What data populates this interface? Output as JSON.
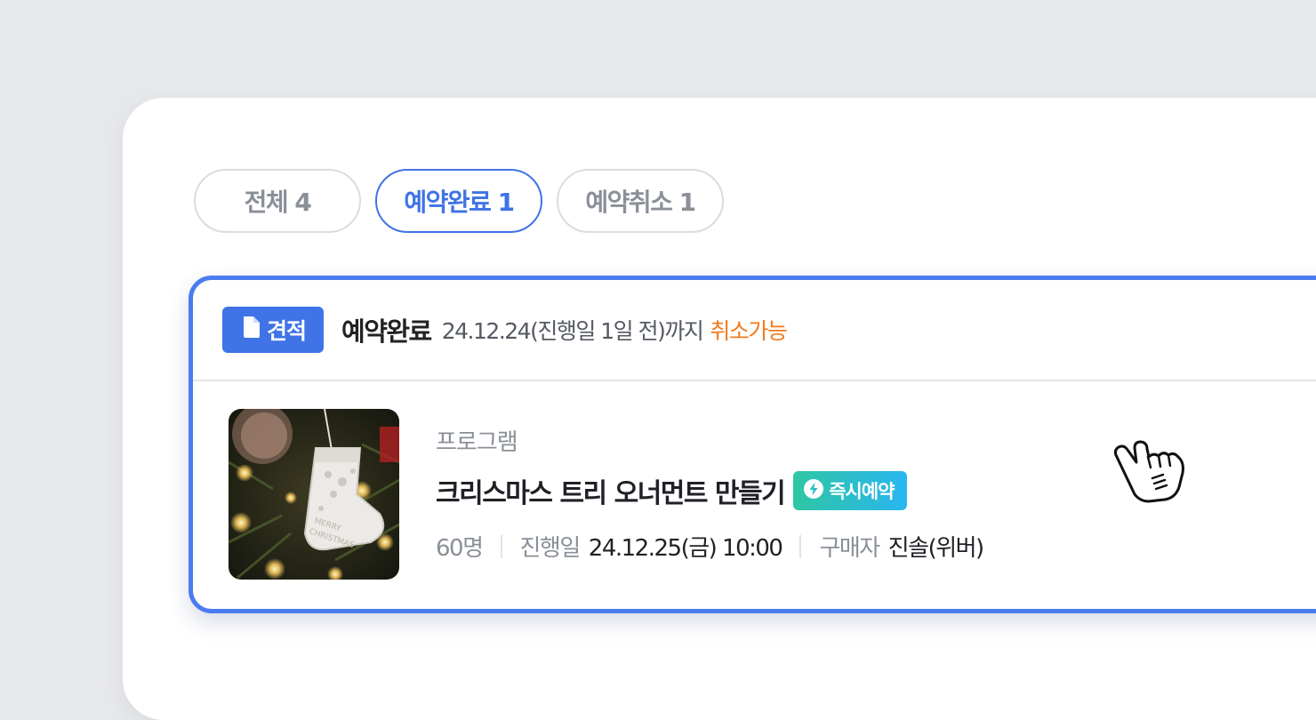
{
  "tabs": [
    {
      "label": "전체 4",
      "active": false
    },
    {
      "label": "예약완료 1",
      "active": true
    },
    {
      "label": "예약취소 1",
      "active": false
    }
  ],
  "card": {
    "estimate_badge": "견적",
    "status": "예약완료",
    "deadline_text": "24.12.24(진행일 1일 전)까지",
    "cancel_text": "취소가능",
    "category": "프로그램",
    "title": "크리스마스 트리 오너먼트 만들기",
    "instant_badge": "즉시예약",
    "people": "60명",
    "date_label": "진행일",
    "date_value": "24.12.25(금) 10:00",
    "buyer_label": "구매자",
    "buyer_value": "진솔(위버)"
  },
  "colors": {
    "accent": "#3f73e6",
    "card_border": "#4a7cf0",
    "cancel_orange": "#f07a1e",
    "instant_gradient_start": "#2fc6a4",
    "instant_gradient_end": "#29b6f0"
  },
  "icons": {
    "estimate": "document-icon",
    "instant": "lightning-icon",
    "cursor": "hand-pointer-icon"
  }
}
